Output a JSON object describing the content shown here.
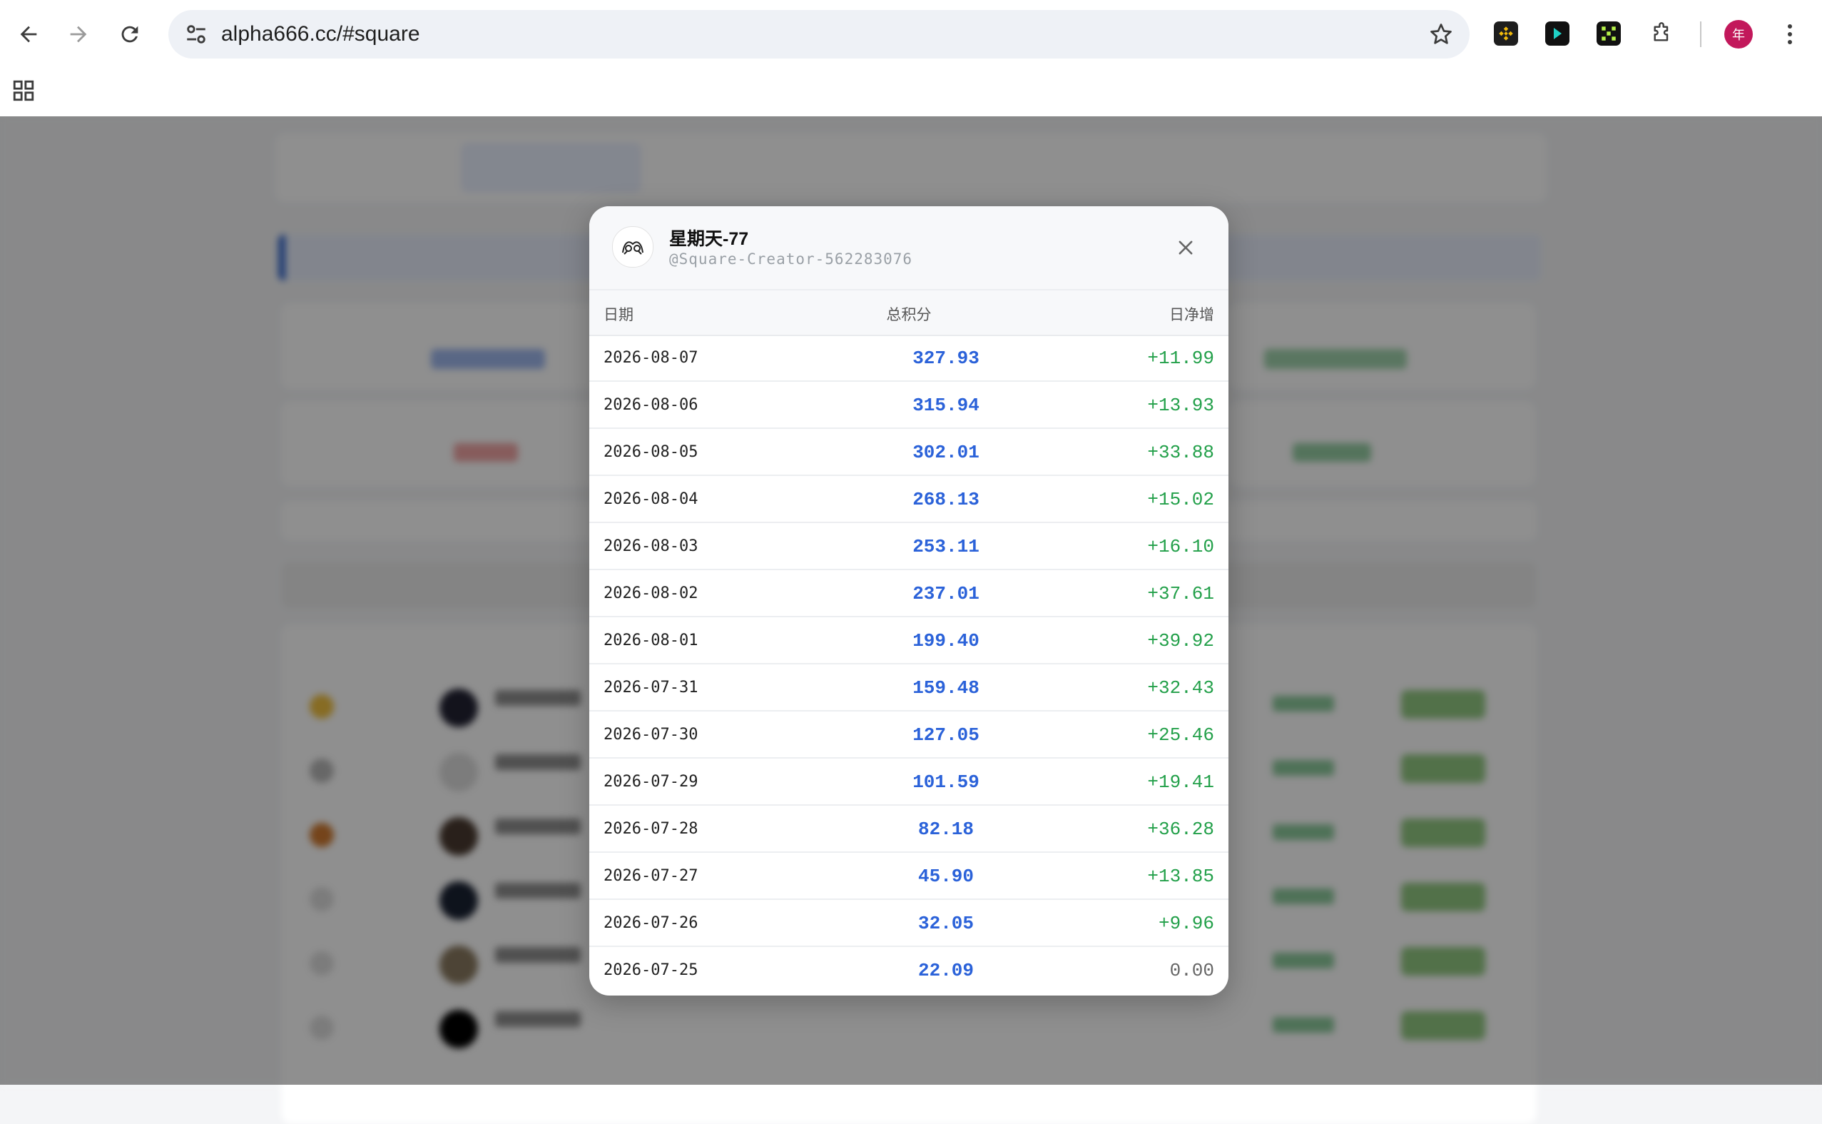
{
  "browser": {
    "url": "alpha666.cc/#square",
    "profile_initial": "年"
  },
  "modal": {
    "user_name": "星期天-77",
    "user_handle": "@Square-Creator-562283076",
    "columns": [
      "日期",
      "总积分",
      "日净增"
    ],
    "rows": [
      {
        "date": "2026-08-07",
        "points": "327.93",
        "net": "+11.99"
      },
      {
        "date": "2026-08-06",
        "points": "315.94",
        "net": "+13.93"
      },
      {
        "date": "2026-08-05",
        "points": "302.01",
        "net": "+33.88"
      },
      {
        "date": "2026-08-04",
        "points": "268.13",
        "net": "+15.02"
      },
      {
        "date": "2026-08-03",
        "points": "253.11",
        "net": "+16.10"
      },
      {
        "date": "2026-08-02",
        "points": "237.01",
        "net": "+37.61"
      },
      {
        "date": "2026-08-01",
        "points": "199.40",
        "net": "+39.92"
      },
      {
        "date": "2026-07-31",
        "points": "159.48",
        "net": "+32.43"
      },
      {
        "date": "2026-07-30",
        "points": "127.05",
        "net": "+25.46"
      },
      {
        "date": "2026-07-29",
        "points": "101.59",
        "net": "+19.41"
      },
      {
        "date": "2026-07-28",
        "points": "82.18",
        "net": "+36.28"
      },
      {
        "date": "2026-07-27",
        "points": "45.90",
        "net": "+13.85"
      },
      {
        "date": "2026-07-26",
        "points": "32.05",
        "net": "+9.96"
      },
      {
        "date": "2026-07-25",
        "points": "22.09",
        "net": "0.00"
      }
    ]
  },
  "colors": {
    "points_blue": "#2b62d9",
    "net_green": "#23a04a",
    "overlay": "rgba(0,0,0,0.44)"
  }
}
